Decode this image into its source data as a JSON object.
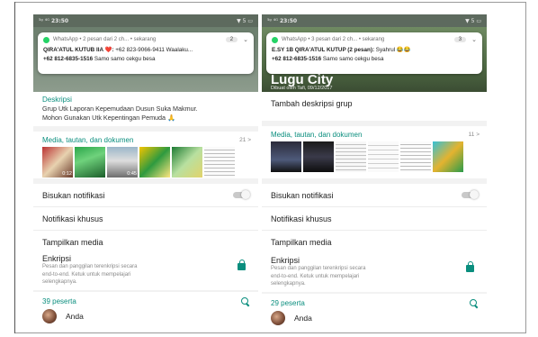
{
  "left": {
    "status": {
      "time_text": "23:50",
      "left_text": "⁵ᵍ ⁴ᴳ",
      "right_text": "▼ 5 ▭"
    },
    "notification": {
      "app": "WhatsApp",
      "summary": "WhatsApp • 2 pesan dari 2 ch... • sekarang",
      "count": "2",
      "line1_sender": "QIRA'ATUL KUTUB IIA ❤️:",
      "line1_text": " +62 823-9066-9411  Waalaku...",
      "line2_sender": "+62 812-6835-1516",
      "line2_text": "  Samo samo cekgu besa"
    },
    "description": {
      "label": "Deskripsi",
      "text1": "Grup Utk Laporan Kepemudaan Dusun Suka Makmur.",
      "text2": "Mohon Gunakan Utk Kepentingan Pemuda 🙏"
    },
    "media": {
      "label": "Media, tautan, dan dokumen",
      "count": "21 >",
      "durations": [
        "0:12",
        "",
        "0:45",
        "",
        "",
        ""
      ]
    },
    "rows": {
      "mute": "Bisukan notifikasi",
      "custom": "Notifikasi khusus",
      "show_media": "Tampilkan media"
    },
    "encryption": {
      "title": "Enkripsi",
      "text1": "Pesan dan panggilan terenkripsi secara",
      "text2": "end-to-end. Ketuk untuk mempelajari",
      "text3": "selengkapnya."
    },
    "participants": {
      "label": "39 peserta",
      "first_member": "Anda"
    }
  },
  "right": {
    "status": {
      "time_text": "23:50",
      "left_text": "⁵ᵍ ⁴ᴳ",
      "right_text": "▼ 5 ▭"
    },
    "notification": {
      "app": "WhatsApp",
      "summary": "WhatsApp • 3 pesan dari 2 ch... • sekarang",
      "count": "3",
      "line1_sender": "E.SY 1B QIRA'ATUL KUTUP (2 pesan):",
      "line1_text": " Syahrul 😂😂",
      "line2_sender": "+62 812-6835-1516",
      "line2_text": "  Samo samo cekgu besa"
    },
    "group": {
      "title": "Lugu City",
      "created": "Dibuat oleh Tafi, 09/12/2017"
    },
    "add_description": "Tambah deskripsi grup",
    "media": {
      "label": "Media, tautan, dan dokumen",
      "count": "11 >",
      "durations": [
        "",
        "",
        "",
        "",
        "",
        ""
      ]
    },
    "rows": {
      "mute": "Bisukan notifikasi",
      "custom": "Notifikasi khusus",
      "show_media": "Tampilkan media"
    },
    "encryption": {
      "title": "Enkripsi",
      "text1": "Pesan dan panggilan terenkripsi secara",
      "text2": "end-to-end. Ketuk untuk mempelajari",
      "text3": "selengkapnya."
    },
    "participants": {
      "label": "29 peserta",
      "first_member": "Anda"
    }
  },
  "colors": {
    "accent": "#0a8e7e",
    "whatsapp_green": "#25d366",
    "statusbar": "#5d6a5e"
  }
}
